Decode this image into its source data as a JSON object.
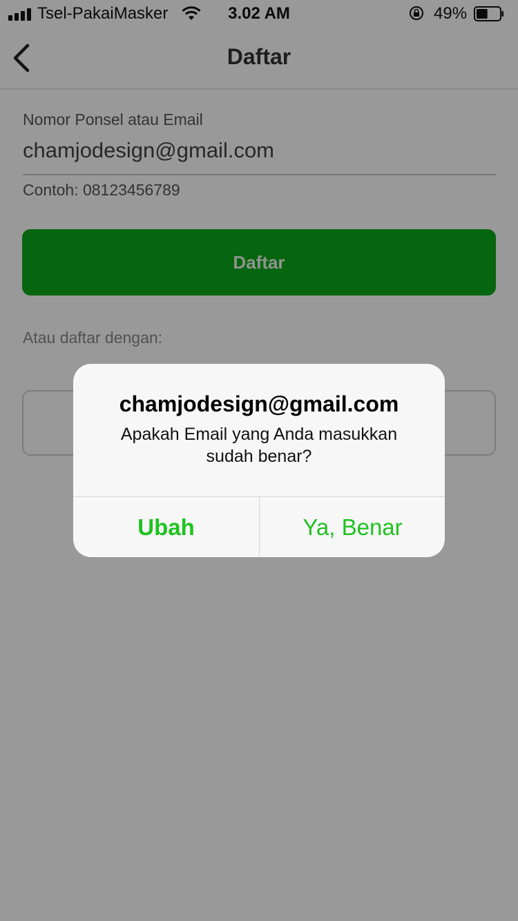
{
  "status_bar": {
    "carrier": "Tsel-PakaiMasker",
    "time": "3.02 AM",
    "battery_percent": "49%",
    "battery_level": 0.49,
    "icons": [
      "signal-icon",
      "wifi-icon",
      "rotation-lock-icon",
      "battery-icon"
    ]
  },
  "nav": {
    "title": "Daftar",
    "back_icon": "chevron-left-icon"
  },
  "form": {
    "field_label": "Nomor Ponsel atau Email",
    "field_value": "chamjodesign@gmail.com",
    "hint": "Contoh: 08123456789",
    "register_label": "Daftar",
    "alt_label": "Atau daftar dengan:"
  },
  "alert": {
    "title": "chamjodesign@gmail.com",
    "message": "Apakah Email yang Anda masukkan sudah benar?",
    "left_button": "Ubah",
    "right_button": "Ya, Benar"
  },
  "colors": {
    "accent": "#1fc21f",
    "button_green": "#0aa81a",
    "overlay": "rgba(0,0,0,0.40)"
  }
}
